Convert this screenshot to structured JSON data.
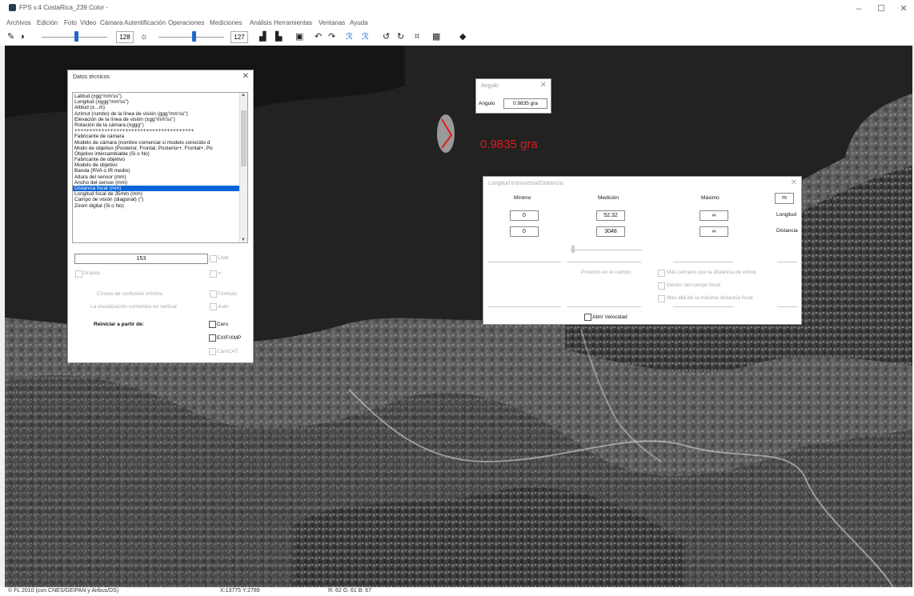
{
  "window": {
    "title": "FPS v.4 CostaRica_239 Color -",
    "controls": [
      "–",
      "☐",
      "✕"
    ]
  },
  "menu": [
    "Archivos",
    "Edición",
    "Foto",
    "Video",
    "Cámara",
    "Autentificación",
    "Operaciones",
    "Mediciones",
    "Análisis",
    "Herramientas",
    "Ventanas",
    "Ayuda"
  ],
  "toolbar": {
    "brightness_value": "128",
    "contrast_value": "127",
    "icons": [
      "pencil-icon",
      "contrast-icon",
      "sun-icon",
      "bar-chart-icon",
      "save-icon",
      "undo-icon",
      "redo-icon",
      "rotate-left-icon",
      "rotate-right-icon",
      "grid-icon",
      "eye-icon"
    ]
  },
  "tech_panel": {
    "title": "Datos técnicos",
    "close": "✕",
    "items": [
      "Latitud (±gg°mm'ss\")",
      "Longitud (±ggg°mm'ss\")",
      "Altitud (±...m)",
      "Azimut (rumbo) de la línea de visión (ggg°mm'ss\")",
      "Elevación de la línea de visión (±gg°mm'ss\")",
      "Rotación de la cámara (±ggg°)",
      "++++++++++++++++++++++++++++++++++++++++",
      "Fabricante de cámara",
      "Modelo de cámara (nombre comercial si modelo conocido d",
      "Modo de objetivo (Posterior, Frontal, Posterior+, Frontal+, Po",
      "Objetivo intercambiable (Si o No)",
      "Fabricante de objetivo",
      "Modelo de objetivo",
      "Banda (RVA o IR medio)",
      "Altura del sensor (mm)",
      "Ancho del sensor (mm)",
      "Distancia focal (mm)",
      "Longitud focal de 35mm (mm)",
      "Campo de visión (diagonal) (°)",
      "Zoom digital (Si o No)"
    ],
    "selected_index": 16,
    "value": "153",
    "liste_label": "Liste",
    "grados_label": "Grados",
    "inf_label": "∞",
    "circulo_label": "Círculo de confusión mínimo",
    "formula_label": "Fórmula",
    "visualizacion_label": "La visualización corrientes en vertical",
    "auto_label": "Auto",
    "reiniciar_label": "Reiniciar a partir de:",
    "cero_label": "Cero",
    "exif_label": "EXIF/XMP",
    "camcat_label": "CamCAT"
  },
  "angle_panel": {
    "title": "Angulo",
    "close": "✕",
    "label": "Angulo",
    "value": "0.9835 gra"
  },
  "overlay": {
    "angle_text": "0.9835 gra",
    "color": "#e01a1a"
  },
  "distance_panel": {
    "title": "Longitud transversal/Distancia",
    "close": "✕",
    "col_min": "Mínimo",
    "col_med": "Medición",
    "col_max": "Máximo",
    "unit": "m",
    "row1": {
      "min": "0",
      "med": "52.32",
      "max": "∞",
      "label": "Longitud"
    },
    "row2": {
      "min": "0",
      "med": "3048",
      "max": "∞",
      "label": "Distancia"
    },
    "position_label": "Posición en el campo:",
    "opt1": "Más cercano que la distancia de enfoq",
    "opt2": "Dentro del campo focal",
    "opt3": "Más allá de la máxima distancia focal",
    "abrir_label": "Abrir Velocidad"
  },
  "status": {
    "credit": "© FL 2010 (con CNES/GEIPAN y Airbus/DS)",
    "coords": "X:13775 Y:2789",
    "rgb": "R: 62 G: 61 B: 67"
  }
}
